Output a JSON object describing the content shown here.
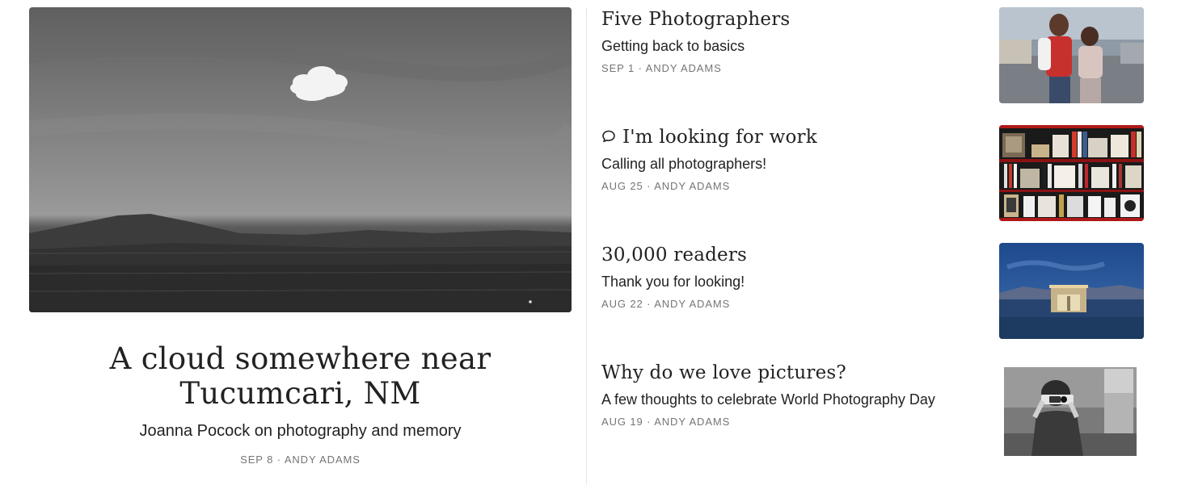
{
  "featured": {
    "image_name": "cloud-near-tucumcari-photo",
    "title": "A cloud somewhere near Tucumcari, NM",
    "subtitle": "Joanna Pocock on photography and memory",
    "date": "SEP 8",
    "separator": "·",
    "author": "ANDY ADAMS"
  },
  "posts": [
    {
      "title": "Five Photographers",
      "subtitle": "Getting back to basics",
      "date": "SEP 1",
      "separator": "·",
      "author": "ANDY ADAMS",
      "thumbnail": "two-children-portrait-photo"
    },
    {
      "title": "I'm looking for work",
      "subtitle": "Calling all photographers!",
      "date": "AUG 25",
      "separator": "·",
      "author": "ANDY ADAMS",
      "thumbnail": "bookshelf-photo",
      "icon": "comment-icon"
    },
    {
      "title": "30,000 readers",
      "subtitle": "Thank you for looking!",
      "date": "AUG 22",
      "separator": "·",
      "author": "ANDY ADAMS",
      "thumbnail": "desert-building-dusk-photo"
    },
    {
      "title": "Why do we love pictures?",
      "subtitle": "A few thoughts to celebrate World Photography Day",
      "date": "AUG 19",
      "separator": "·",
      "author": "ANDY ADAMS",
      "thumbnail": "woman-with-camera-bw-photo"
    }
  ],
  "colors": {
    "text": "#222222",
    "meta": "#757575",
    "divider": "#e6e6e6"
  }
}
